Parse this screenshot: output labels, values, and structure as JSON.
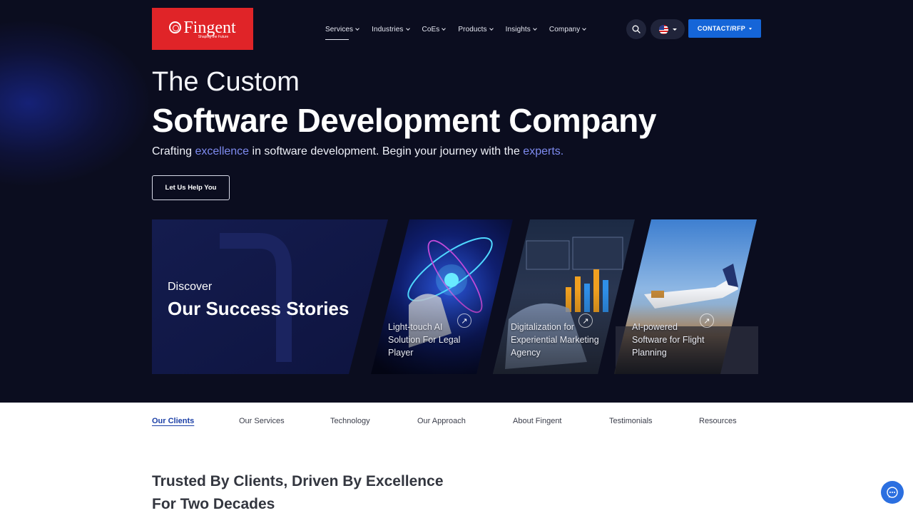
{
  "brand": {
    "name": "Fingent",
    "tagline": "Shaping the Future",
    "color": "#e02428"
  },
  "nav": {
    "items": [
      {
        "label": "Services",
        "active": true
      },
      {
        "label": "Industries"
      },
      {
        "label": "CoEs"
      },
      {
        "label": "Products"
      },
      {
        "label": "Insights"
      },
      {
        "label": "Company"
      }
    ],
    "search_icon": "search-icon",
    "language_icon": "us-flag-icon",
    "contact_label": "CONTACT/RFP"
  },
  "hero": {
    "title_line1": "The Custom",
    "title_line2": "Software Development Company",
    "sub_part1": "Crafting ",
    "sub_hl1": "excellence",
    "sub_part2": " in software development. Begin your journey with the ",
    "sub_hl2": "experts.",
    "cta_label": "Let Us Help You",
    "background_color": "#0b0d1f",
    "highlight_color": "#7e8bf0"
  },
  "stories": {
    "kicker": "Discover",
    "heading": "Our Success Stories",
    "cards": [
      {
        "line1": "Light-touch AI",
        "line2": "Solution For Legal",
        "line3": "Player"
      },
      {
        "line1": "Digitalization for",
        "line2": "Experiential Marketing",
        "line3": "Agency"
      },
      {
        "line1": "AI-powered",
        "line2": "Software for Flight",
        "line3": "Planning"
      }
    ]
  },
  "subnav": {
    "items": [
      {
        "label": "Our Clients",
        "active": true
      },
      {
        "label": "Our Services"
      },
      {
        "label": "Technology"
      },
      {
        "label": "Our Approach"
      },
      {
        "label": "About Fingent"
      },
      {
        "label": "Testimonials"
      },
      {
        "label": "Resources"
      }
    ]
  },
  "section": {
    "title_line1": "Trusted By Clients, Driven By Excellence",
    "title_line2": "For Two Decades"
  },
  "chat": {
    "icon": "chat-bubble-icon",
    "color": "#2b6fe0"
  }
}
